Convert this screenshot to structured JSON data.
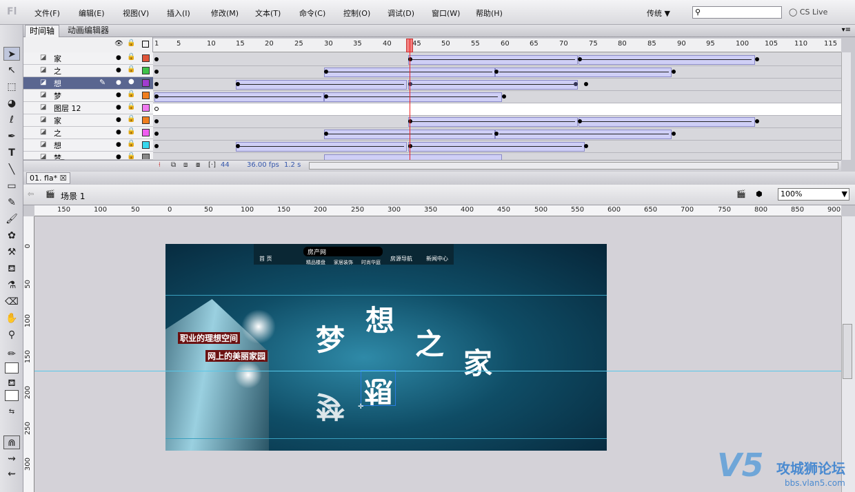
{
  "menubar": {
    "items": [
      "文件(F)",
      "编辑(E)",
      "视图(V)",
      "插入(I)",
      "修改(M)",
      "文本(T)",
      "命令(C)",
      "控制(O)",
      "调试(D)",
      "窗口(W)",
      "帮助(H)"
    ],
    "workspace": "传统 ▼",
    "search_placeholder": "",
    "cslive": "CS Live"
  },
  "timeline": {
    "tabs": [
      "时间轴",
      "动画编辑器"
    ],
    "ruler": [
      "1",
      "5",
      "10",
      "15",
      "20",
      "25",
      "30",
      "35",
      "40",
      "45",
      "50",
      "55",
      "60",
      "65",
      "70",
      "75",
      "80",
      "85",
      "90",
      "95",
      "100",
      "105",
      "110",
      "115"
    ],
    "layers": [
      {
        "name": "家",
        "color": "#e0553a"
      },
      {
        "name": "之",
        "color": "#3fc24a"
      },
      {
        "name": "想",
        "color": "#a23bd0"
      },
      {
        "name": "梦",
        "color": "#f07e1e"
      },
      {
        "name": "图层 12",
        "color": "#f07af0"
      },
      {
        "name": "家",
        "color": "#f07e1e"
      },
      {
        "name": "之",
        "color": "#f05cf0"
      },
      {
        "name": "想",
        "color": "#38d8ee"
      },
      {
        "name": "梦",
        "color": "#888888"
      }
    ],
    "status": {
      "frame": "44",
      "fps": "36.00 fps",
      "time": "1.2 s"
    }
  },
  "document": {
    "tab": "01. fla*",
    "scene": "场景 1",
    "zoom": "100%"
  },
  "hruler": [
    "150",
    "100",
    "50",
    "0",
    "50",
    "100",
    "150",
    "200",
    "250",
    "300",
    "350",
    "400",
    "450",
    "500",
    "550",
    "600",
    "650",
    "700",
    "750",
    "800",
    "850",
    "900"
  ],
  "vruler": [
    "0",
    "50",
    "100",
    "150",
    "200",
    "250",
    "300"
  ],
  "stage": {
    "nav": [
      "首 页",
      "房产网",
      "精品楼盘",
      "家居装饰",
      "时尚华庭",
      "房源导航",
      "新闻中心"
    ],
    "chars": [
      "梦",
      "想",
      "之",
      "家",
      "梦",
      "想"
    ],
    "slogans": [
      "职业的理想空间",
      "网上的美丽家园"
    ]
  },
  "watermark": {
    "brand": "V5",
    "title": "攻城狮论坛",
    "url": "bbs.vlan5.com"
  }
}
